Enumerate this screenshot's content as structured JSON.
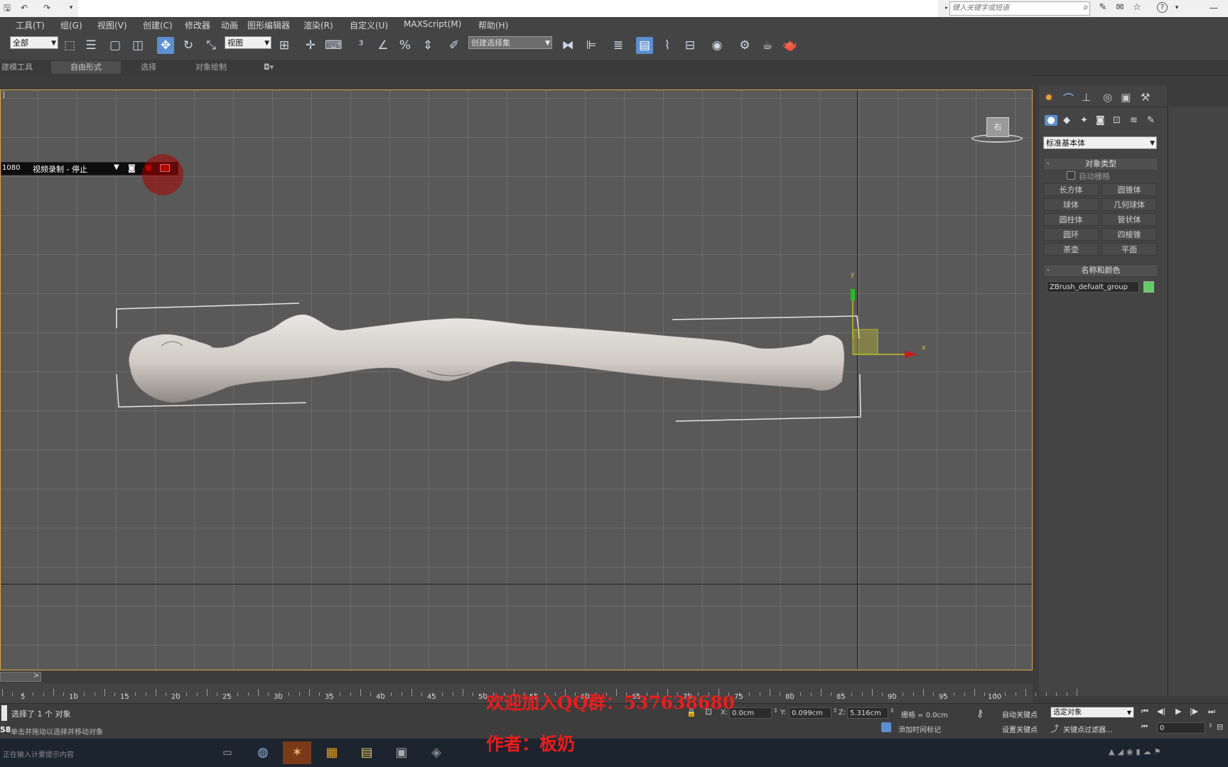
{
  "window": {
    "search_placeholder": "键入关键字或短语"
  },
  "menu": [
    "工具(T)",
    "组(G)",
    "视图(V)",
    "创建(C)",
    "修改器",
    "动画",
    "图形编辑器",
    "渲染(R)",
    "自定义(U)",
    "MAXScript(M)",
    "帮助(H)"
  ],
  "toolbar": {
    "selection_filter": "全部",
    "ref_coord": "视图",
    "named_selection": "创建选择集",
    "active_tool": "select-and-move"
  },
  "ribbon": {
    "tabs": [
      "建模工具",
      "自由形式",
      "选择",
      "对象绘制"
    ],
    "selected": "自由形式"
  },
  "viewport": {
    "label": "]",
    "view_cube_label": "右",
    "recorder": {
      "resolution": "1080",
      "status": "视频录制 - 停止"
    },
    "gizmo": {
      "y_label": "y",
      "x_label": "x"
    }
  },
  "command_panel": {
    "dropdown": "标准基本体",
    "object_type": {
      "title": "对象类型",
      "autogrid": "自动栅格",
      "buttons": [
        "长方体",
        "圆锥体",
        "球体",
        "几何球体",
        "圆柱体",
        "管状体",
        "圆环",
        "四棱锥",
        "茶壶",
        "平面"
      ]
    },
    "name_color": {
      "title": "名称和颜色",
      "name": "ZBrush_defualt_group",
      "color": "#5fcf5f"
    }
  },
  "timeline": {
    "labels": [
      "5",
      "10",
      "15",
      "20",
      "25",
      "30",
      "35",
      "40",
      "45",
      "50",
      "55",
      "60",
      "65",
      "70",
      "75",
      "80",
      "85",
      "90",
      "95",
      "100"
    ]
  },
  "status": {
    "selection": "选择了 1 个 对象",
    "prompt": "单击并拖动以选择并移动对象",
    "prompt_num": "58",
    "x_label": "X:",
    "x": "0.0cm",
    "y_label": "Y:",
    "y": "0.099cm",
    "z_label": "Z:",
    "z": "5.316cm",
    "grid": "栅格 = 0.0cm",
    "add_time_tag": "添加时间标记",
    "auto_key": "自动关键点",
    "set_key": "设置关键点",
    "key_mode": "选定对象",
    "key_filters": "关键点过滤器...",
    "frame": "0",
    "left_hint": "正在输入计要提示内容"
  },
  "watermark": {
    "line1": "欢迎加入QQ群：537638680",
    "line2": "作者：板奶"
  },
  "colors": {
    "viewport_border": "#e0a64a",
    "record_red": "#cc0000",
    "accent_blue": "#5b8fd0"
  }
}
